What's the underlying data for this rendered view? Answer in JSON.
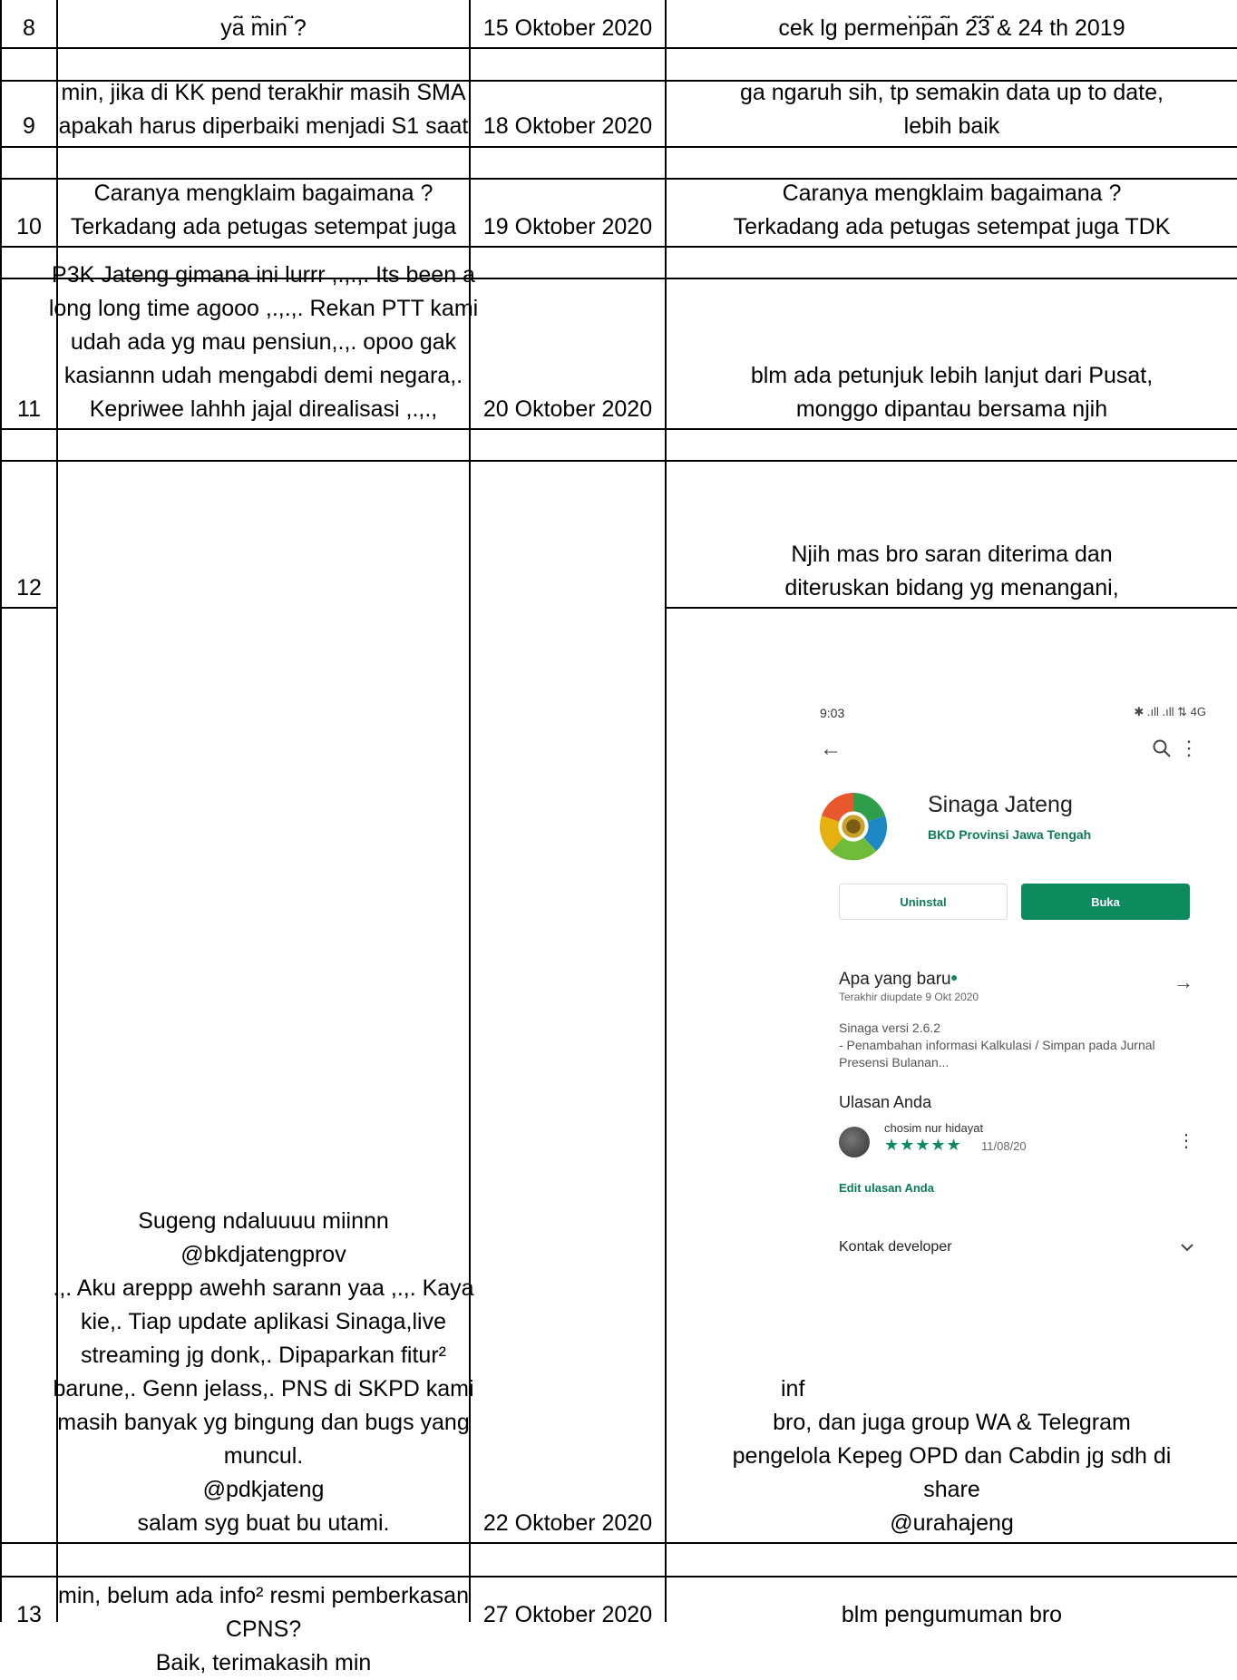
{
  "rows": [
    {
      "no": "8",
      "question": [
        "ya min ?"
      ],
      "date": "15 Oktober 2020",
      "answer": [
        "cek lg permenpan 23 & 24 th 2019"
      ]
    },
    {
      "no": "9",
      "question": [
        "min, jika di KK pend terakhir masih SMA",
        "apakah harus diperbaiki menjadi S1 saat"
      ],
      "date": "18 Oktober 2020",
      "answer": [
        "ga ngaruh sih, tp semakin data up to date,",
        "lebih baik"
      ]
    },
    {
      "no": "10",
      "question": [
        "Caranya mengklaim bagaimana ?",
        "Terkadang ada petugas setempat juga"
      ],
      "date": "19 Oktober 2020",
      "answer": [
        "Caranya mengklaim bagaimana ?",
        "Terkadang ada petugas setempat juga TDK"
      ]
    },
    {
      "no": "11",
      "question": [
        "P3K Jateng gimana ini lurrr ,.,.,. Its been a",
        "long long time agooo ,.,.,. Rekan PTT kami",
        "udah ada yg mau pensiun,.,. opoo gak",
        "kasiannn udah mengabdi demi negara,.",
        "Kepriwee lahhh jajal direalisasi ,.,.,"
      ],
      "date": "20 Oktober 2020",
      "answer": [
        "blm ada petunjuk lebih lanjut dari Pusat,",
        "monggo dipantau bersama njih"
      ]
    },
    {
      "no": "12",
      "question": [
        "Sugeng ndaluuuu miinnn",
        "@bkdjatengprov",
        ".,. Aku areppp awehh sarann yaa ,.,. Kaya",
        "kie,. Tiap update aplikasi Sinaga,live",
        "streaming jg donk,. Dipaparkan fitur²",
        "barune,. Genn jelass,. PNS di SKPD kami",
        "masih banyak yg bingung dan bugs yang",
        "muncul.",
        "@pdkjateng",
        "salam syg buat bu utami."
      ],
      "date": "22 Oktober 2020",
      "answer_top": [
        "Njih mas bro saran diterima dan",
        "diteruskan bidang yg menangani,"
      ],
      "answer_bottom": [
        "inf",
        "bro, dan juga group WA & Telegram",
        "pengelola Kepeg OPD dan Cabdin jg sdh di",
        "share",
        "@urahajeng"
      ]
    },
    {
      "no": "13",
      "question": [
        "min, belum ada info² resmi pemberkasan",
        "CPNS?",
        "Baik, terimakasih min"
      ],
      "date": "27 Oktober 2020",
      "answer": [
        "blm pengumuman bro"
      ]
    }
  ],
  "phone": {
    "time": "9:03",
    "status": "✱ .ıll .ıll ⇅ 4G",
    "app_name": "Sinaga Jateng",
    "developer": "BKD Provinsi Jawa Tengah",
    "uninstall_label": "Uninstal",
    "open_label": "Buka",
    "whats_new_title": "Apa yang baru",
    "whats_new_updated": "Terakhir diupdate 9 Okt 2020",
    "whats_new_notes": [
      "Sinaga versi 2.6.2",
      "- Penambahan informasi Kalkulasi / Simpan pada Jurnal",
      "Presensi Bulanan..."
    ],
    "reviews_title": "Ulasan Anda",
    "reviewer_name": "chosim nur hidayat",
    "review_stars": "★★★★★",
    "review_date": "11/08/20",
    "edit_review_label": "Edit ulasan Anda",
    "contact_developer_label": "Kontak developer",
    "accent_color": "#0e8a5f"
  }
}
